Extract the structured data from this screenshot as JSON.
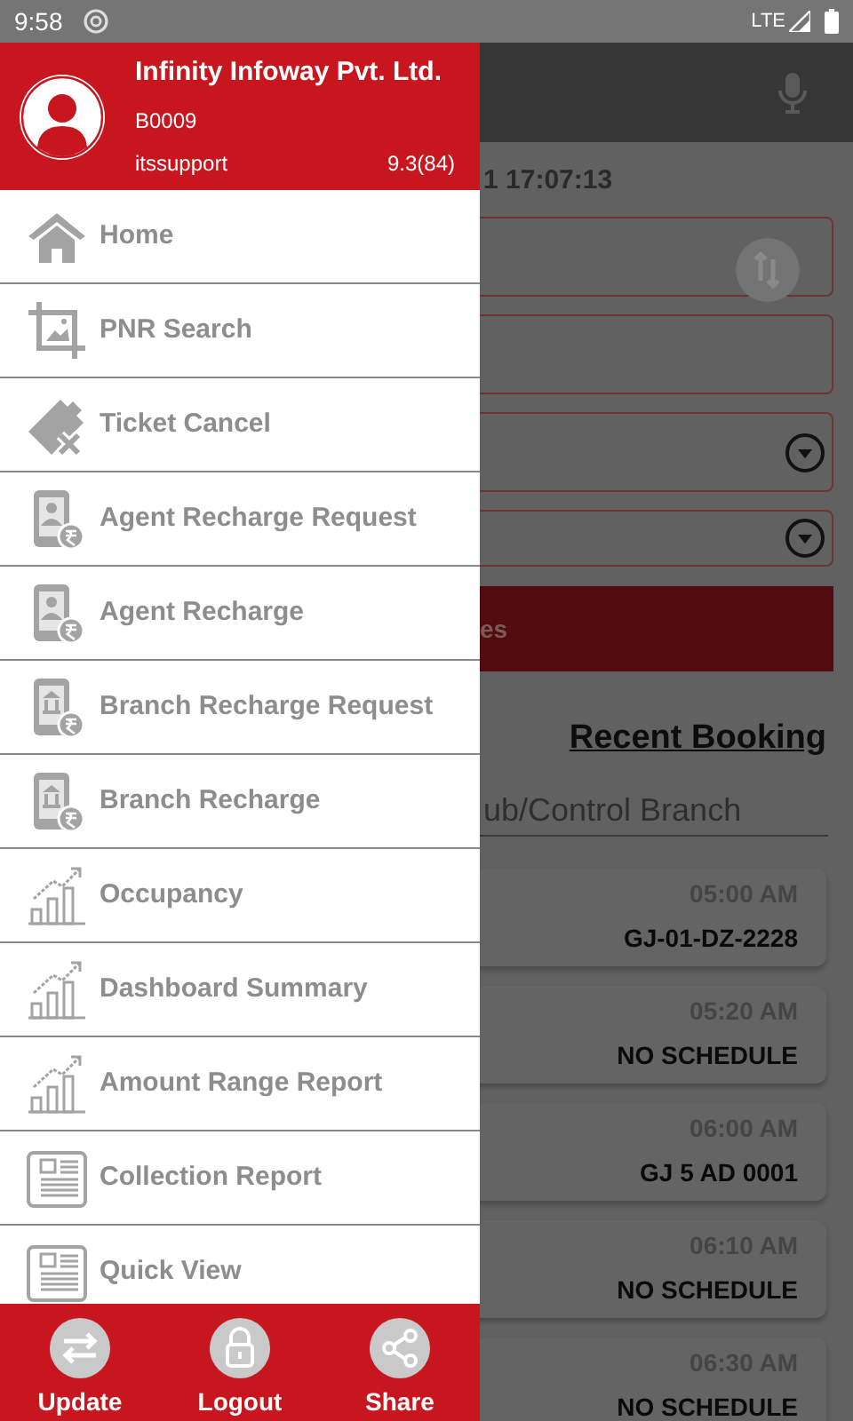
{
  "status_bar": {
    "time": "9:58",
    "network": "LTE"
  },
  "drawer": {
    "company": "Infinity Infoway Pvt. Ltd.",
    "code": "B0009",
    "user": "itssupport",
    "version": "9.3(84)",
    "items": [
      {
        "label": "Home",
        "kind": "home"
      },
      {
        "label": "PNR Search",
        "kind": "crop"
      },
      {
        "label": "Ticket Cancel",
        "kind": "ticket"
      },
      {
        "label": "Agent Recharge Request",
        "kind": "agent"
      },
      {
        "label": "Agent Recharge",
        "kind": "agent"
      },
      {
        "label": "Branch Recharge Request",
        "kind": "branch"
      },
      {
        "label": "Branch Recharge",
        "kind": "branch"
      },
      {
        "label": "Occupancy",
        "kind": "chart"
      },
      {
        "label": "Dashboard Summary",
        "kind": "chart"
      },
      {
        "label": "Amount Range Report",
        "kind": "chart"
      },
      {
        "label": "Collection Report",
        "kind": "report"
      },
      {
        "label": "Quick View",
        "kind": "report"
      }
    ],
    "footer": [
      {
        "label": "Update",
        "kind": "update"
      },
      {
        "label": "Logout",
        "kind": "lock"
      },
      {
        "label": "Share",
        "kind": "share"
      }
    ]
  },
  "background": {
    "date": "1 17:07:13",
    "button": "es",
    "recent_title": "Recent Booking",
    "branch_placeholder": "ub/Control Branch",
    "bookings": [
      {
        "time": "05:00 AM",
        "vehicle": "GJ-01-DZ-2228"
      },
      {
        "time": "05:20 AM",
        "vehicle": "NO SCHEDULE"
      },
      {
        "time": "06:00 AM",
        "vehicle": "GJ 5 AD 0001"
      },
      {
        "time": "06:10 AM",
        "vehicle": "NO SCHEDULE"
      },
      {
        "time": "06:30 AM",
        "vehicle": "NO SCHEDULE"
      }
    ]
  }
}
